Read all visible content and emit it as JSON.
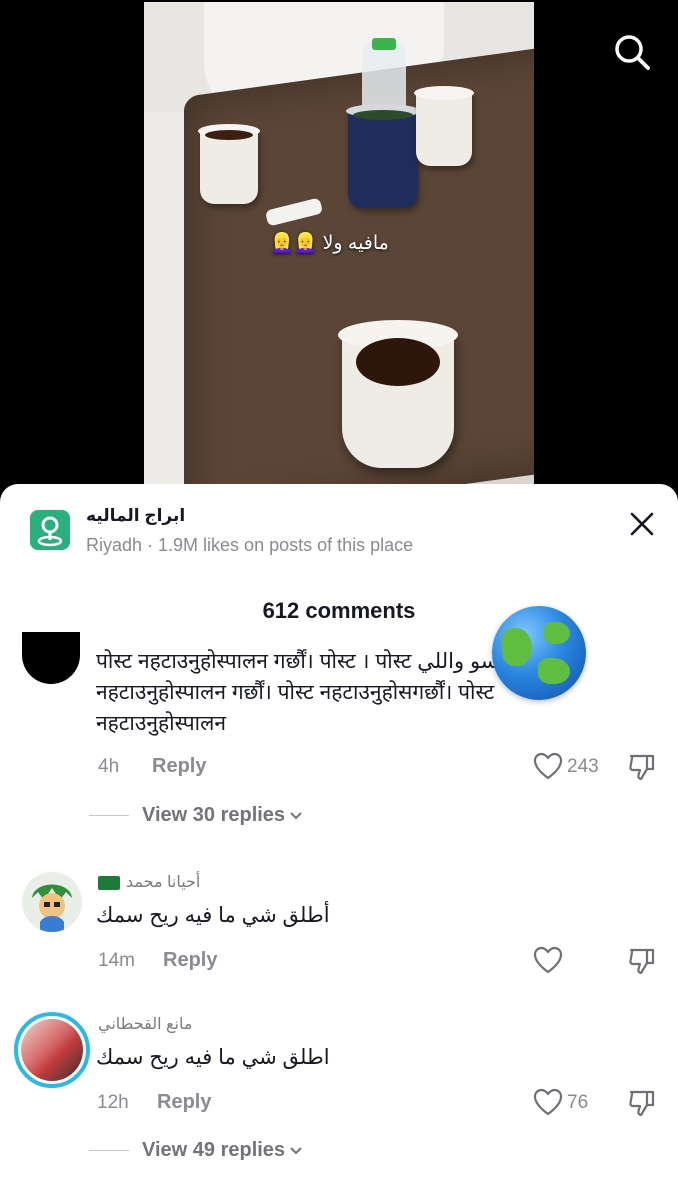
{
  "video": {
    "overlay_text": "مافيه ولا 👱‍♀️👱‍♀️",
    "search_icon": "search-icon"
  },
  "place": {
    "name": "ابراج الماليه",
    "subtitle": "Riyadh · 1.9M likes on posts of this place",
    "icon": "map-pin-icon"
  },
  "comments_header": {
    "count_label": "612 comments"
  },
  "comments": [
    {
      "lines": [
        "पोस्ट नहटाउनुहोस्पालन गर्छौं। पोस्ट । पोस्ट ؟ سو    واللي",
        "नहटाउनुहोस्पालन गर्छौं। पोस्ट नहटाउनुहोसगर्छौं। पोस्ट",
        "नहटाउनुहोस्पालन"
      ],
      "time": "4h",
      "reply_label": "Reply",
      "likes": "243",
      "view_replies": "View 30 replies"
    },
    {
      "username": "أحيانا محمد",
      "text": "أطلق شي ما فيه ريح سمك",
      "time": "14m",
      "reply_label": "Reply",
      "likes": ""
    },
    {
      "username": "مانع القحطاني",
      "text": "اطلق شي ما فيه ريح سمك",
      "time": "12h",
      "reply_label": "Reply",
      "likes": "76",
      "view_replies": "View 49 replies"
    }
  ],
  "colors": {
    "accent_green": "#2ab07d",
    "text_primary": "#161823",
    "text_secondary": "#8a8b91",
    "avatar_ring": "#28b9e6"
  }
}
